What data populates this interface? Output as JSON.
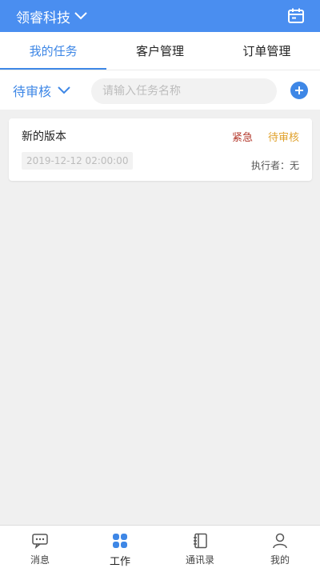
{
  "header": {
    "company": "领睿科技"
  },
  "tabs": [
    {
      "label": "我的任务",
      "active": true
    },
    {
      "label": "客户管理",
      "active": false
    },
    {
      "label": "订单管理",
      "active": false
    }
  ],
  "filter": {
    "status": "待审核",
    "search_placeholder": "请输入任务名称"
  },
  "tasks": [
    {
      "title": "新的版本",
      "priority": "紧急",
      "status": "待审核",
      "time": "2019-12-12 02:00:00",
      "executor": "执行者：无"
    }
  ],
  "nav": [
    {
      "label": "消息",
      "icon": "message-icon"
    },
    {
      "label": "工作",
      "icon": "work-grid-icon",
      "active": true
    },
    {
      "label": "通讯录",
      "icon": "contacts-book-icon"
    },
    {
      "label": "我的",
      "icon": "user-icon"
    }
  ],
  "colors": {
    "primary": "#3e87e6",
    "header": "#4a8ef0",
    "urgent": "#b43a2e",
    "pending": "#e0a12b"
  }
}
